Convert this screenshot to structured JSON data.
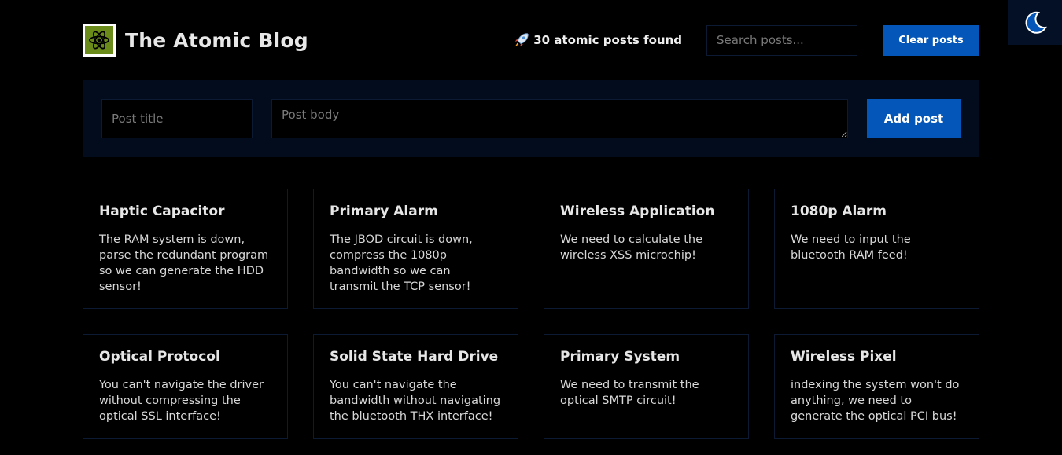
{
  "header": {
    "title": "The Atomic Blog",
    "post_count_text": "30 atomic posts found",
    "search_placeholder": "Search posts...",
    "clear_label": "Clear posts"
  },
  "form": {
    "title_placeholder": "Post title",
    "body_placeholder": "Post body",
    "add_label": "Add post"
  },
  "icons": {
    "logo": "atom-icon",
    "count": "rocket-icon",
    "theme": "moon-icon"
  },
  "colors": {
    "accent": "#0456b8",
    "background": "#000000",
    "panel": "#020c1c",
    "logo_bg": "#6a8a1a"
  },
  "posts": [
    {
      "title": "Haptic Capacitor",
      "body": "The RAM system is down, parse the redundant program so we can generate the HDD sensor!"
    },
    {
      "title": "Primary Alarm",
      "body": "The JBOD circuit is down, compress the 1080p bandwidth so we can transmit the TCP sensor!"
    },
    {
      "title": "Wireless Application",
      "body": "We need to calculate the wireless XSS microchip!"
    },
    {
      "title": "1080p Alarm",
      "body": "We need to input the bluetooth RAM feed!"
    },
    {
      "title": "Optical Protocol",
      "body": "You can't navigate the driver without compressing the optical SSL interface!"
    },
    {
      "title": "Solid State Hard Drive",
      "body": "You can't navigate the bandwidth without navigating the bluetooth THX interface!"
    },
    {
      "title": "Primary System",
      "body": "We need to transmit the optical SMTP circuit!"
    },
    {
      "title": "Wireless Pixel",
      "body": "indexing the system won't do anything, we need to generate the optical PCI bus!"
    }
  ]
}
